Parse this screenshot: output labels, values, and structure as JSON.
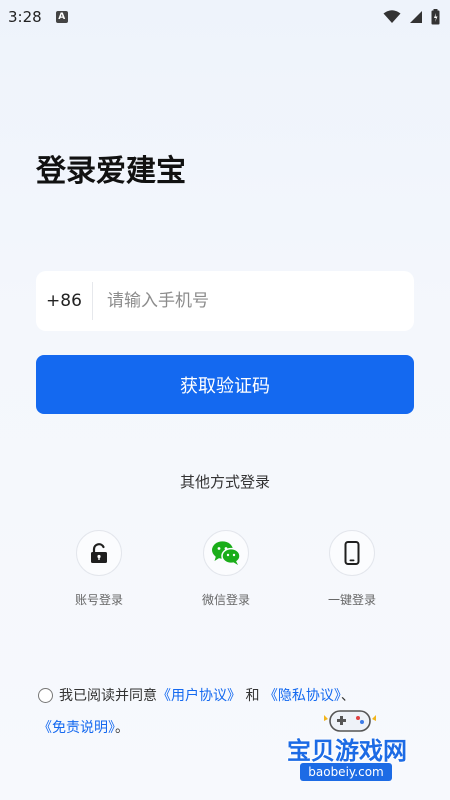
{
  "status_bar": {
    "time": "3:28",
    "notification_glyph": "A",
    "icons": [
      "wifi-icon",
      "signal-icon",
      "battery-icon"
    ]
  },
  "page": {
    "title": "登录爱建宝"
  },
  "phone": {
    "country_code": "+86",
    "placeholder": "请输入手机号",
    "value": ""
  },
  "get_code_button": "获取验证码",
  "other_methods": {
    "title": "其他方式登录",
    "items": [
      {
        "label": "账号登录",
        "icon": "lock-icon"
      },
      {
        "label": "微信登录",
        "icon": "wechat-icon"
      },
      {
        "label": "一键登录",
        "icon": "phone-icon"
      }
    ]
  },
  "agreement": {
    "prefix": "我已阅读并同意",
    "user_agreement": "《用户协议》",
    "and": "和",
    "privacy_policy": "《隐私协议》",
    "separator": "、",
    "disclaimer": "《免责说明》",
    "end": "。",
    "checked": false
  },
  "watermark": {
    "text": "宝贝游戏网",
    "url": "baobeiy.com"
  },
  "colors": {
    "accent": "#1469f0",
    "wechat": "#1aad19",
    "background": "#f4f7fc"
  }
}
